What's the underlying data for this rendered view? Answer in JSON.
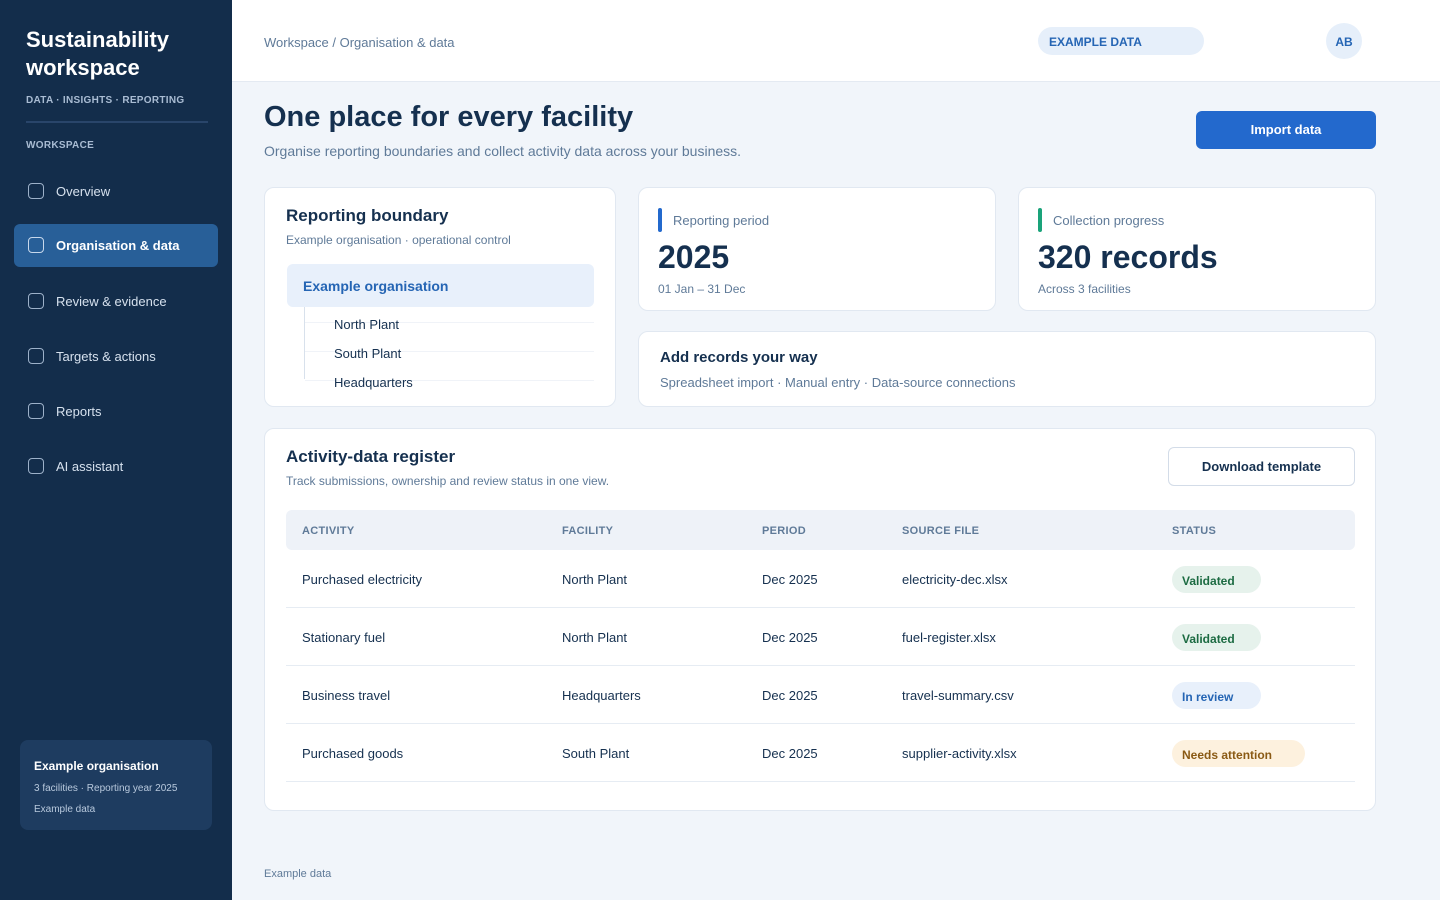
{
  "sidebar": {
    "title": "Sustainability workspace",
    "subtitle": "DATA · INSIGHTS · REPORTING",
    "section_label": "WORKSPACE",
    "items": [
      {
        "label": "Overview"
      },
      {
        "label": "Organisation & data",
        "active": true
      },
      {
        "label": "Review & evidence"
      },
      {
        "label": "Targets & actions"
      },
      {
        "label": "Reports"
      },
      {
        "label": "AI assistant"
      }
    ],
    "org_card": {
      "title": "Example organisation",
      "line1": "3 facilities · Reporting year 2025",
      "line2": "Example data"
    }
  },
  "header": {
    "breadcrumb": "Workspace / Organisation & data",
    "badge": "EXAMPLE DATA",
    "avatar": "AB"
  },
  "page": {
    "title": "One place for every facility",
    "subtitle": "Organise reporting boundaries and collect activity data across your business.",
    "import_button": "Import data"
  },
  "boundary": {
    "title": "Reporting boundary",
    "subtitle": "Example organisation · operational control",
    "root": "Example organisation",
    "children": [
      "North Plant",
      "South Plant",
      "Headquarters"
    ]
  },
  "period": {
    "label": "Reporting period",
    "value": "2025",
    "sub": "01 Jan – 31 Dec",
    "accent": "#2369cd"
  },
  "progress": {
    "label": "Collection progress",
    "value": "320 records",
    "sub": "Across 3 facilities",
    "accent": "#1aa37a"
  },
  "add_records": {
    "title": "Add records your way",
    "subtitle": "Spreadsheet import · Manual entry · Data-source connections"
  },
  "register": {
    "title": "Activity-data register",
    "subtitle": "Track submissions, ownership and review status in one view.",
    "download_button": "Download template",
    "columns": [
      "ACTIVITY",
      "FACILITY",
      "PERIOD",
      "SOURCE FILE",
      "STATUS"
    ],
    "rows": [
      {
        "activity": "Purchased electricity",
        "facility": "North Plant",
        "period": "Dec 2025",
        "file": "electricity-dec.xlsx",
        "status": "Validated"
      },
      {
        "activity": "Stationary fuel",
        "facility": "North Plant",
        "period": "Dec 2025",
        "file": "fuel-register.xlsx",
        "status": "Validated"
      },
      {
        "activity": "Business travel",
        "facility": "Headquarters",
        "period": "Dec 2025",
        "file": "travel-summary.csv",
        "status": "In review"
      },
      {
        "activity": "Purchased goods",
        "facility": "South Plant",
        "period": "Dec 2025",
        "file": "supplier-activity.xlsx",
        "status": "Needs attention"
      }
    ]
  },
  "footer": {
    "note": "Example data"
  }
}
